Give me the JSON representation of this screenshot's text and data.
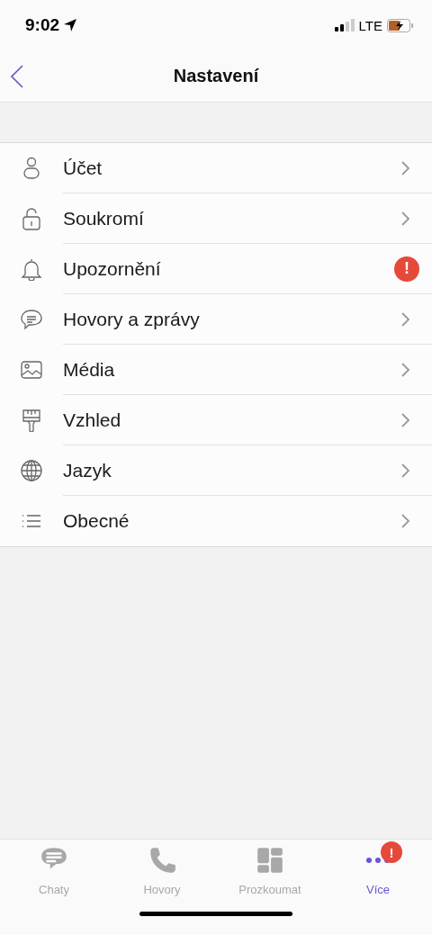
{
  "status_bar": {
    "time": "9:02",
    "network": "LTE"
  },
  "nav": {
    "title": "Nastavení"
  },
  "settings": [
    {
      "label": "Účet"
    },
    {
      "label": "Soukromí"
    },
    {
      "label": "Upozornění",
      "badge": "!"
    },
    {
      "label": "Hovory a zprávy"
    },
    {
      "label": "Média"
    },
    {
      "label": "Vzhled"
    },
    {
      "label": "Jazyk"
    },
    {
      "label": "Obecné"
    }
  ],
  "tabs": [
    {
      "label": "Chaty",
      "selected": false
    },
    {
      "label": "Hovory",
      "selected": false
    },
    {
      "label": "Prozkoumat",
      "selected": false
    },
    {
      "label": "Více",
      "selected": true,
      "badge": "!"
    }
  ]
}
